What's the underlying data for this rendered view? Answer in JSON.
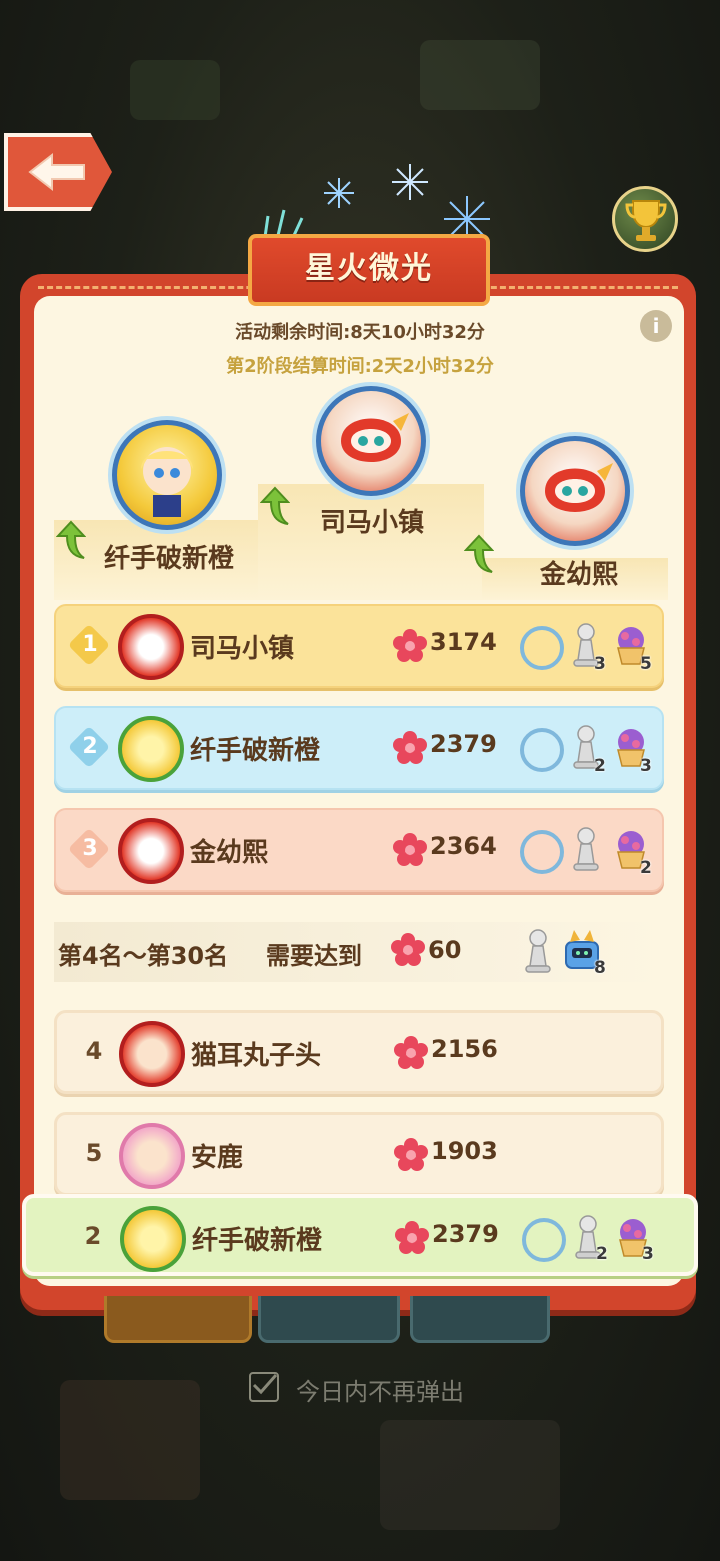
{
  "event": {
    "title": "星火微光",
    "time_remaining": "活动剩余时间:8天10小时32分",
    "stage_settlement": "第2阶段结算时间:2天2小时32分"
  },
  "podium": [
    {
      "place": 1,
      "name": "司马小镇"
    },
    {
      "place": 2,
      "name": "纤手破新橙"
    },
    {
      "place": 3,
      "name": "金幼熙"
    }
  ],
  "ranks": [
    {
      "rank": "1",
      "name": "司马小镇",
      "score": "3174",
      "pawn_count": "3",
      "basket_count": "5",
      "style": "gold"
    },
    {
      "rank": "2",
      "name": "纤手破新橙",
      "score": "2379",
      "pawn_count": "2",
      "basket_count": "3",
      "style": "blue"
    },
    {
      "rank": "3",
      "name": "金幼熙",
      "score": "2364",
      "pawn_count": "",
      "basket_count": "2",
      "style": "pink"
    }
  ],
  "threshold": {
    "range_label": "第4名～第30名",
    "need_label": "需要达到",
    "score": "60",
    "reward_count": "8"
  },
  "others": [
    {
      "rank": "4",
      "name": "猫耳丸子头",
      "score": "2156"
    },
    {
      "rank": "5",
      "name": "安鹿",
      "score": "1903"
    }
  ],
  "self": {
    "rank": "2",
    "name": "纤手破新橙",
    "score": "2379",
    "pawn_count": "2",
    "basket_count": "3"
  },
  "footer": {
    "dont_show_today": "今日内不再弹出"
  },
  "colors": {
    "panel_red": "#d2452c",
    "cream": "#fdf6e1",
    "gold_row": "#fbe39a",
    "blue_row": "#cdeef9",
    "pink_row": "#fbd9c6",
    "self_row": "#e3f3c0"
  },
  "icons": {
    "back": "left-arrow-icon",
    "trophy": "trophy-icon",
    "info": "info-icon",
    "score": "flower-icon",
    "reward1": "ring-frame-icon",
    "reward2": "pawn-icon",
    "reward3": "flower-basket-icon"
  }
}
